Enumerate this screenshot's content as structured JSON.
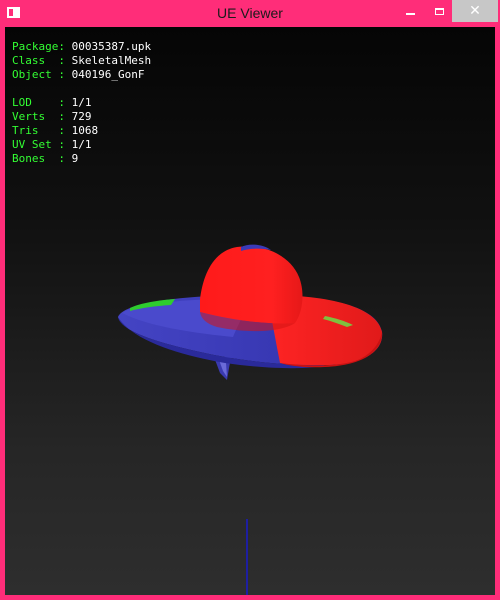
{
  "window": {
    "title": "UE Viewer",
    "close_glyph": "✕",
    "icons": [
      "app-icon",
      "minimize-icon",
      "maximize-icon",
      "close-icon"
    ],
    "colors": {
      "frame": "#ff2d79",
      "label_green": "#33ff33",
      "value_white": "#ffffff",
      "mesh_red": "#ff1f1f",
      "mesh_blue": "#3a3ab8",
      "mesh_green": "#2ecc2e"
    }
  },
  "info": {
    "package_label": "Package:",
    "package_value": "00035387.upk",
    "class_label": "Class  :",
    "class_value": "SkeletalMesh",
    "object_label": "Object :",
    "object_value": "040196_GonF",
    "lod_label": "LOD    :",
    "lod_value": "1/1",
    "verts_label": "Verts  :",
    "verts_value": "729",
    "tris_label": "Tris   :",
    "tris_value": "1068",
    "uvset_label": "UV Set :",
    "uvset_value": "1/1",
    "bones_label": "Bones  :",
    "bones_value": "9"
  }
}
